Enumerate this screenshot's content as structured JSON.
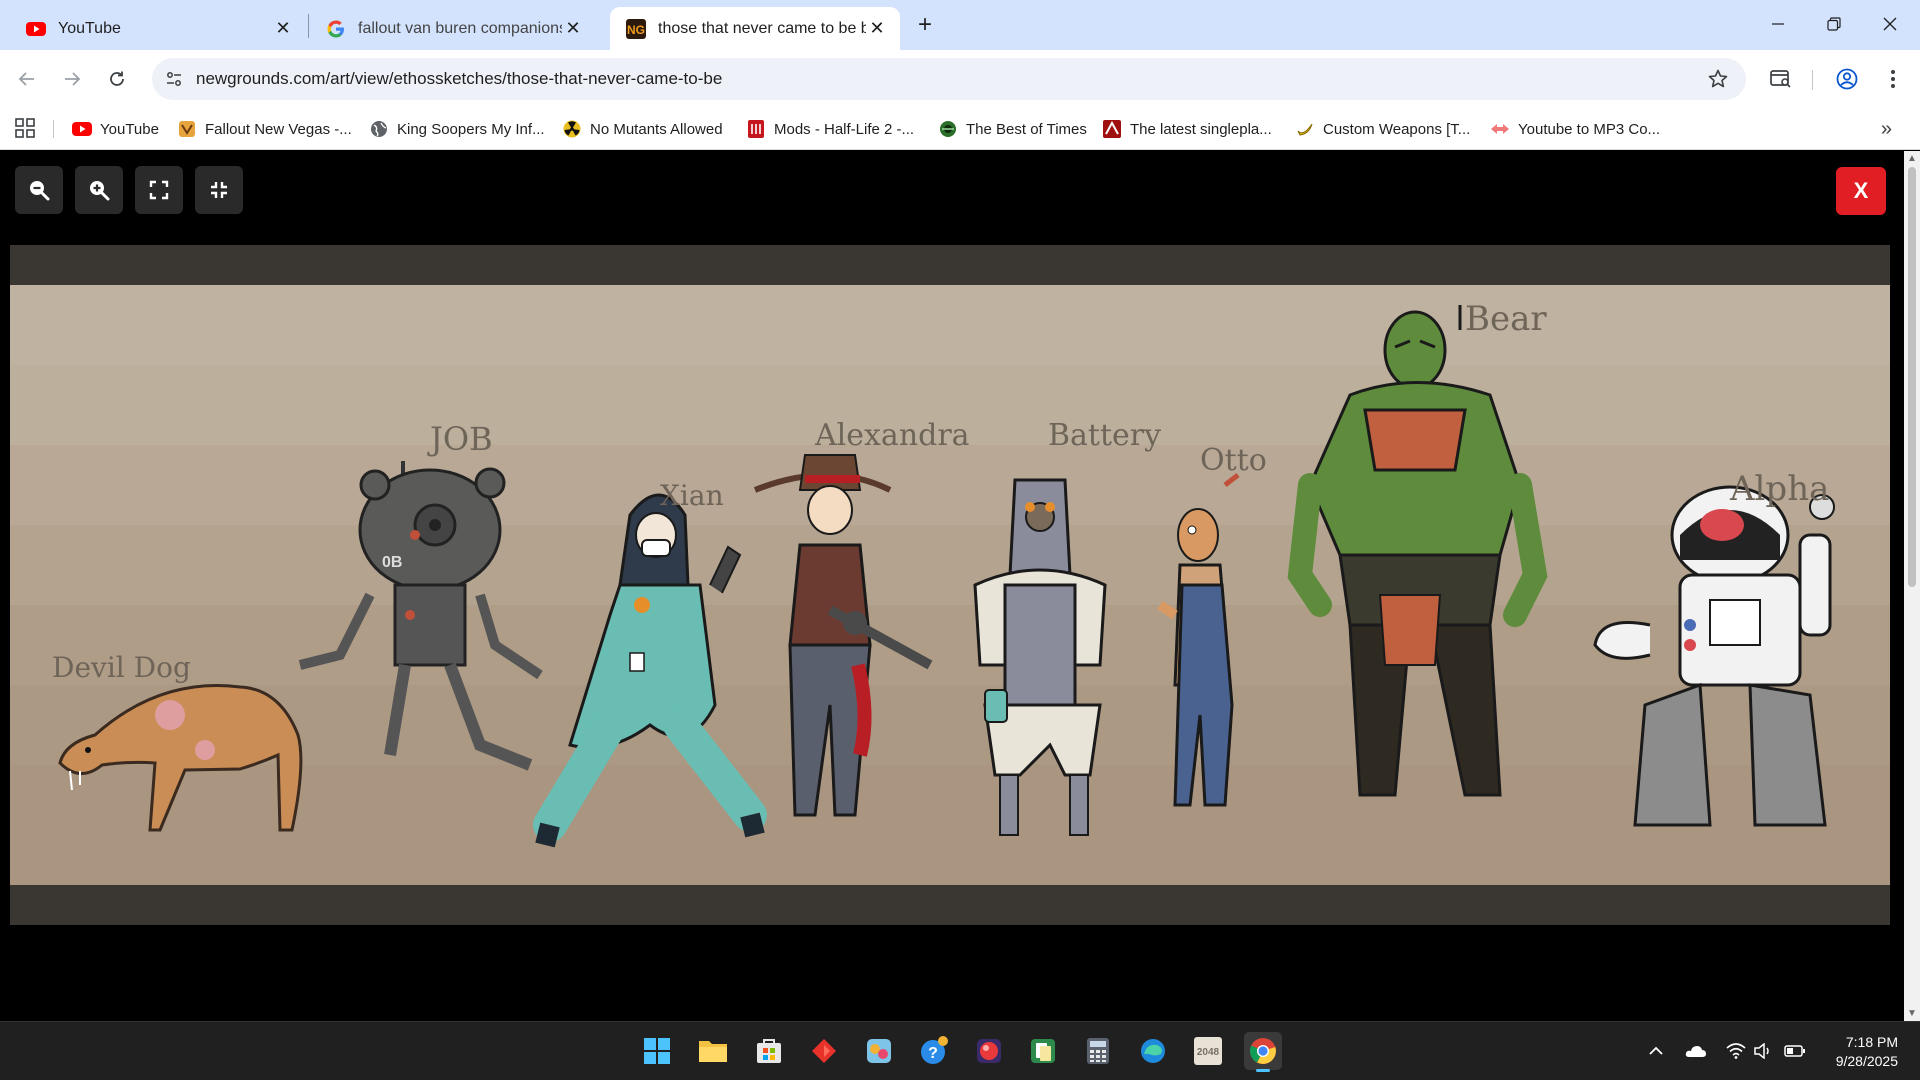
{
  "tabs": [
    {
      "title": "YouTube",
      "icon": "youtube-icon",
      "active": false
    },
    {
      "title": "fallout van buren companions -",
      "icon": "google-icon",
      "active": false
    },
    {
      "title": "those that never came to be by",
      "icon": "newgrounds-icon",
      "active": true
    }
  ],
  "toolbar": {
    "url": "newgrounds.com/art/view/ethossketches/those-that-never-came-to-be"
  },
  "bookmarks": [
    {
      "label": "YouTube",
      "icon": "youtube-icon"
    },
    {
      "label": "Fallout New Vegas -...",
      "icon": "fnv-icon"
    },
    {
      "label": "King Soopers My Inf...",
      "icon": "globe-icon"
    },
    {
      "label": "No Mutants Allowed",
      "icon": "radiation-icon"
    },
    {
      "label": "Mods - Half-Life 2 -...",
      "icon": "moddb-icon"
    },
    {
      "label": "The Best of Times",
      "icon": "fallout-icon"
    },
    {
      "label": "The latest singlepla...",
      "icon": "mod-site-icon"
    },
    {
      "label": "Custom Weapons [T...",
      "icon": "banana-icon"
    },
    {
      "label": "Youtube to MP3 Co...",
      "icon": "converter-icon"
    }
  ],
  "artwork": {
    "characters": [
      "Devil Dog",
      "JOB",
      "Xian",
      "Alexandra",
      "Battery",
      "Otto",
      "Bear",
      "Alpha"
    ],
    "robot_plate": "0B",
    "colors": {
      "background_top": "#c0b2a0",
      "background_bottom": "#aa9680",
      "frame": "#3a3631"
    }
  },
  "viewer": {
    "close_label": "X"
  },
  "taskbar": {
    "apps": [
      "windows-start-icon",
      "file-explorer-icon",
      "microsoft-store-icon",
      "red-app-icon",
      "game-icon",
      "help-icon",
      "candy-game-icon",
      "solitaire-icon",
      "calculator-icon",
      "edge-icon",
      "2048-icon",
      "chrome-icon"
    ],
    "tile_2048": "2048",
    "time": "7:18 PM",
    "date": "9/28/2025"
  },
  "colors": {
    "tabstrip": "#d3e3fd",
    "close_button": "#e01e24",
    "taskbar": "#202020"
  }
}
